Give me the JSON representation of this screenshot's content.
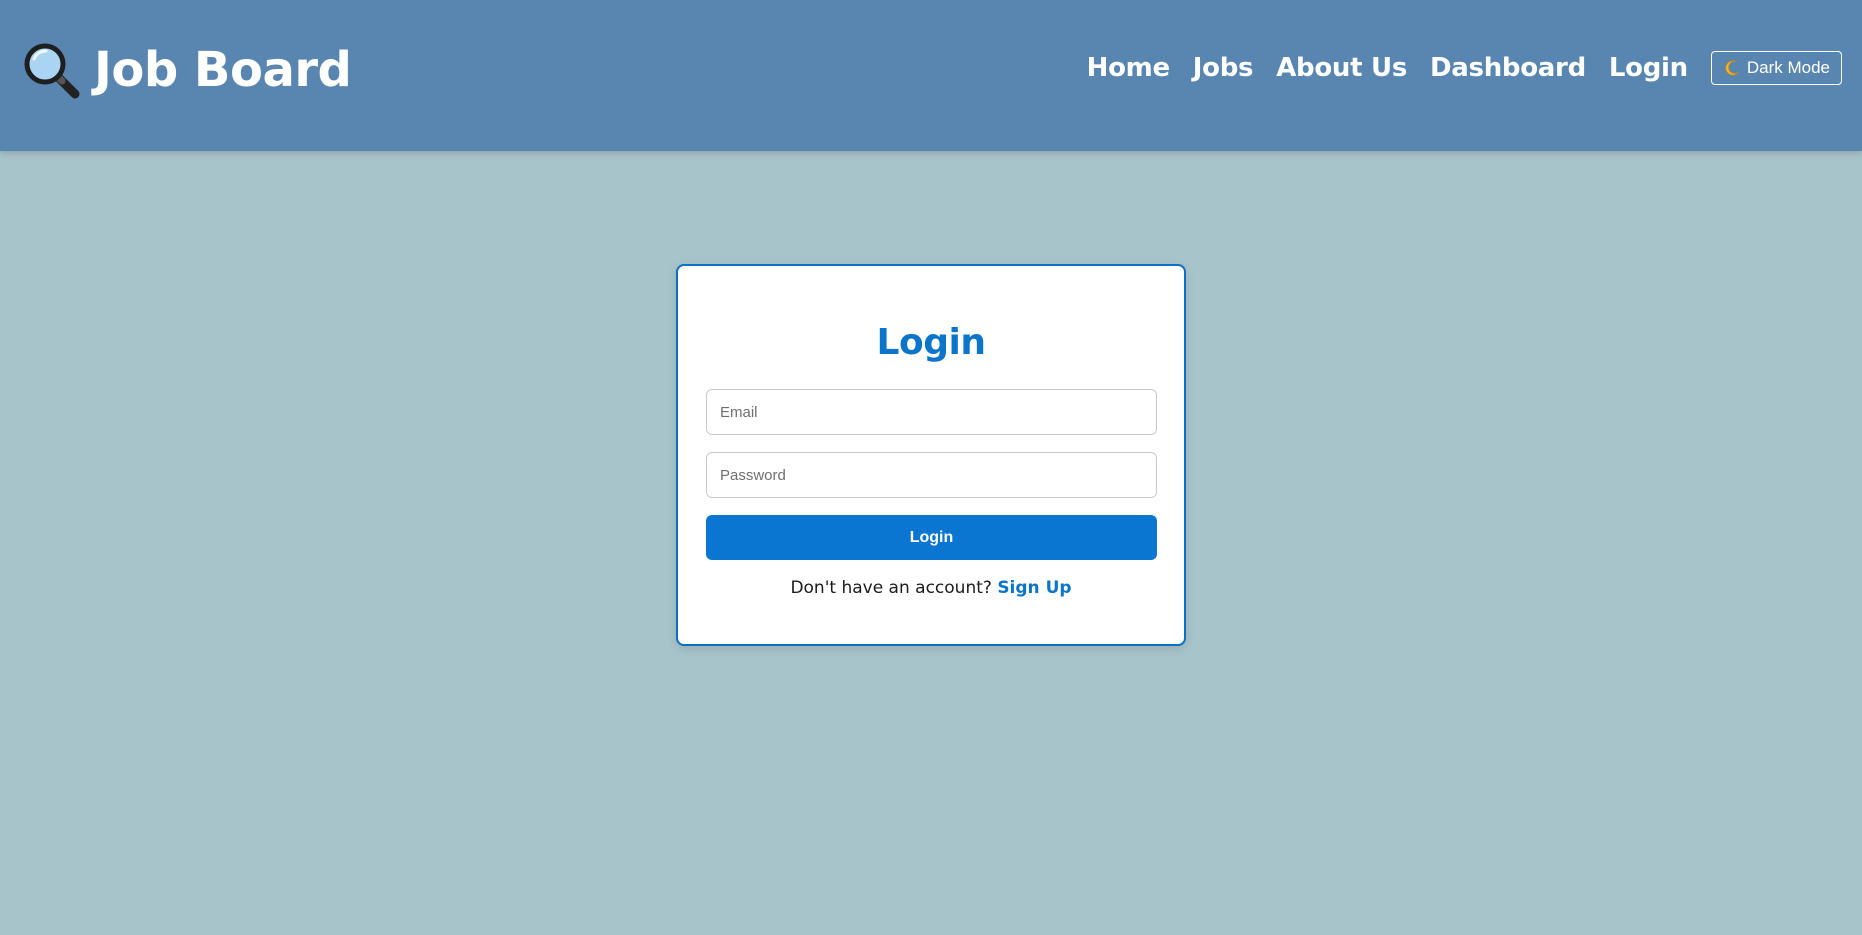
{
  "header": {
    "brand_title": "Job Board",
    "brand_icon": "magnifying-glass-icon",
    "nav": [
      {
        "label": "Home"
      },
      {
        "label": "Jobs"
      },
      {
        "label": "About Us"
      },
      {
        "label": "Dashboard"
      },
      {
        "label": "Login"
      }
    ],
    "dark_mode": {
      "icon": "moon-icon",
      "label": "Dark Mode"
    }
  },
  "login": {
    "title": "Login",
    "email_placeholder": "Email",
    "password_placeholder": "Password",
    "submit_label": "Login",
    "signup_prompt": "Don't have an account?",
    "signup_link": "Sign Up"
  },
  "colors": {
    "header_bg": "#5886b1",
    "page_bg": "#a8c4cb",
    "accent": "#0b75c9",
    "button": "#0b75d2"
  }
}
